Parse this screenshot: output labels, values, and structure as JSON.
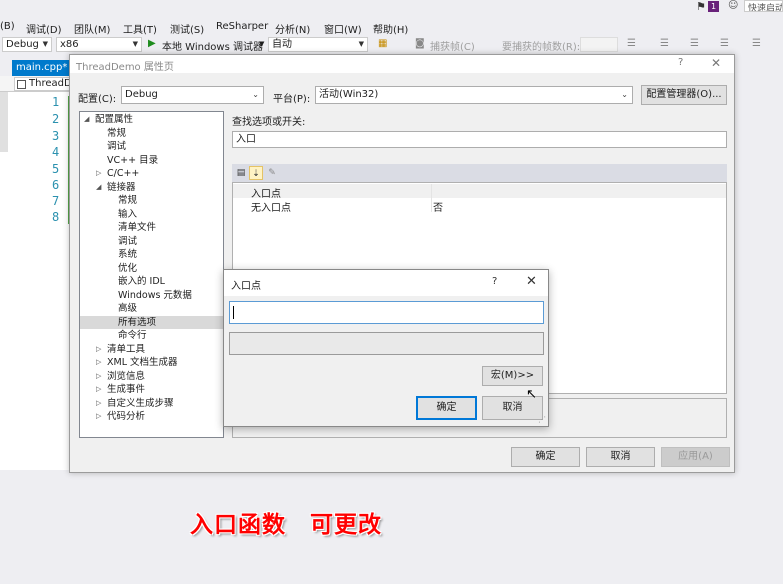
{
  "vs": {
    "menu": [
      "(B)",
      "调试(D)",
      "团队(M)",
      "工具(T)",
      "测试(S)",
      "ReSharper",
      "分析(N)",
      "窗口(W)",
      "帮助(H)"
    ],
    "quick_launch_placeholder": "快速启动",
    "notification_count": "1",
    "toolbar": {
      "config": "Debug",
      "platform": "x86",
      "run_label": "本地 Windows 调试器",
      "auto": "自动",
      "capture_frame": "捕获帧(C)",
      "frames_to_capture": "要捕获的帧数(R):"
    },
    "editor": {
      "tab": "main.cpp*",
      "nav": "ThreadDemo",
      "line_numbers": [
        "1",
        "2",
        "3",
        "4",
        "5",
        "6",
        "7",
        "8"
      ]
    }
  },
  "prop_dialog": {
    "title": "ThreadDemo 属性页",
    "help": "?",
    "close": "✕",
    "config_label": "配置(C):",
    "config_value": "Debug",
    "platform_label": "平台(P):",
    "platform_value": "活动(Win32)",
    "config_manager": "配置管理器(O)...",
    "search_label": "查找选项或开关:",
    "search_value": "入口",
    "tree": [
      {
        "label": "配置属性",
        "indent": 0,
        "arrow": "◢"
      },
      {
        "label": "常规",
        "indent": 2,
        "arrow": ""
      },
      {
        "label": "调试",
        "indent": 2,
        "arrow": ""
      },
      {
        "label": "VC++ 目录",
        "indent": 2,
        "arrow": ""
      },
      {
        "label": "C/C++",
        "indent": 2,
        "arrow": "▷"
      },
      {
        "label": "链接器",
        "indent": 2,
        "arrow": "◢"
      },
      {
        "label": "常规",
        "indent": 3,
        "arrow": ""
      },
      {
        "label": "输入",
        "indent": 3,
        "arrow": ""
      },
      {
        "label": "清单文件",
        "indent": 3,
        "arrow": ""
      },
      {
        "label": "调试",
        "indent": 3,
        "arrow": ""
      },
      {
        "label": "系统",
        "indent": 3,
        "arrow": ""
      },
      {
        "label": "优化",
        "indent": 3,
        "arrow": ""
      },
      {
        "label": "嵌入的 IDL",
        "indent": 3,
        "arrow": ""
      },
      {
        "label": "Windows 元数据",
        "indent": 3,
        "arrow": ""
      },
      {
        "label": "高级",
        "indent": 3,
        "arrow": ""
      },
      {
        "label": "所有选项",
        "indent": 3,
        "arrow": "",
        "selected": true
      },
      {
        "label": "命令行",
        "indent": 3,
        "arrow": ""
      },
      {
        "label": "清单工具",
        "indent": 2,
        "arrow": "▷"
      },
      {
        "label": "XML 文档生成器",
        "indent": 2,
        "arrow": "▷"
      },
      {
        "label": "浏览信息",
        "indent": 2,
        "arrow": "▷"
      },
      {
        "label": "生成事件",
        "indent": 2,
        "arrow": "▷"
      },
      {
        "label": "自定义生成步骤",
        "indent": 2,
        "arrow": "▷"
      },
      {
        "label": "代码分析",
        "indent": 2,
        "arrow": "▷"
      }
    ],
    "grid_rows": [
      {
        "name": "入口点",
        "value": ""
      },
      {
        "name": "无入口点",
        "value": "否"
      }
    ],
    "ok": "确定",
    "cancel": "取消",
    "apply": "应用(A)"
  },
  "entry_dialog": {
    "title": "入口点",
    "help": "?",
    "close": "✕",
    "input_value": "",
    "macro": "宏(M)>>",
    "ok": "确定",
    "cancel": "取消"
  },
  "caption": "入口函数　可更改"
}
